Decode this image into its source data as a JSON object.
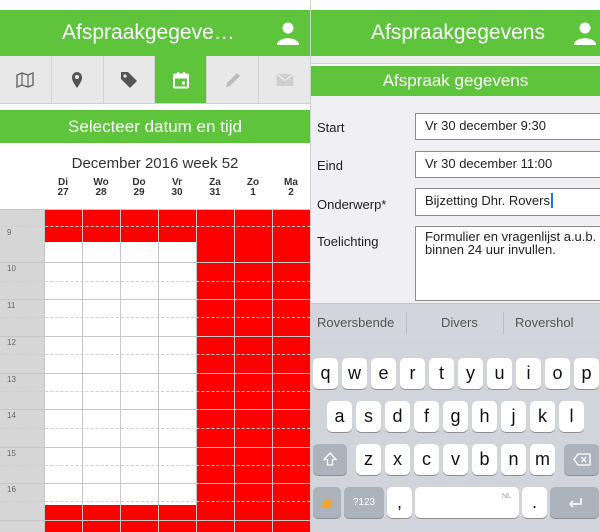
{
  "left": {
    "header": {
      "title": "Afspraakgegeve…",
      "icon": "user-icon"
    },
    "tabs": [
      {
        "icon": "map-icon"
      },
      {
        "icon": "location-pin-icon"
      },
      {
        "icon": "tag-icon"
      },
      {
        "icon": "calendar-icon",
        "active": true
      },
      {
        "icon": "pencil-icon"
      },
      {
        "icon": "mail-icon"
      }
    ],
    "subheader": "Selecteer datum en tijd",
    "week_title": "December 2016 week 52",
    "days": [
      {
        "dow": "Di",
        "date": "27"
      },
      {
        "dow": "Wo",
        "date": "28"
      },
      {
        "dow": "Do",
        "date": "29"
      },
      {
        "dow": "Vr",
        "date": "30"
      },
      {
        "dow": "Za",
        "date": "31"
      },
      {
        "dow": "Zo",
        "date": "1"
      },
      {
        "dow": "Ma",
        "date": "2"
      }
    ],
    "hours": [
      "9",
      "10",
      "11",
      "12",
      "13",
      "14",
      "15",
      "16"
    ]
  },
  "right": {
    "header": {
      "title": "Afspraakgegevens",
      "icon": "user-icon"
    },
    "section_title": "Afspraak gegevens",
    "fields": {
      "start": {
        "label": "Start",
        "value": "Vr 30 december 9:30"
      },
      "end": {
        "label": "Eind",
        "value": "Vr 30 december 11:00"
      },
      "subject": {
        "label": "Onderwerp*",
        "value": "Bijzetting Dhr. Rovers"
      },
      "notes": {
        "label": "Toelichting",
        "value": "Formulier en vragenlijst a.u.b. binnen 24 uur invullen."
      }
    },
    "suggestions": [
      "Roversbende",
      "Divers",
      "Rovershol"
    ],
    "keyboard": {
      "row1": [
        "q",
        "w",
        "e",
        "r",
        "t",
        "y",
        "u",
        "i",
        "o",
        "p"
      ],
      "row2": [
        "a",
        "s",
        "d",
        "f",
        "g",
        "h",
        "j",
        "k",
        "l"
      ],
      "row3": [
        "z",
        "x",
        "c",
        "v",
        "b",
        "n",
        "m"
      ],
      "numbers_key": "?123",
      "comma_key": ",",
      "space_lang": "NL",
      "period_key": "."
    }
  },
  "colors": {
    "green": "#5ec43c",
    "red": "#ff0000",
    "key": "#ffffff"
  }
}
